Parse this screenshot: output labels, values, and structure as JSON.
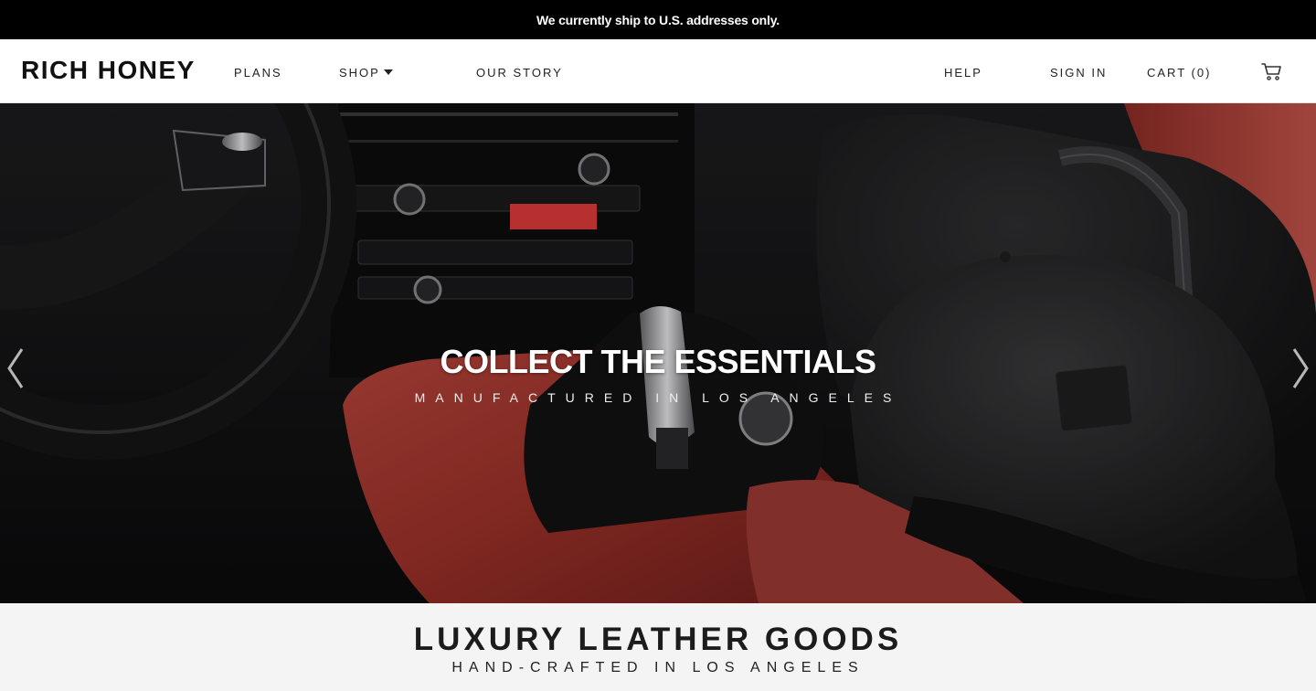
{
  "announcement": {
    "text": "We currently ship to U.S. addresses only."
  },
  "header": {
    "logo": "RICH HONEY",
    "nav_left": [
      {
        "label": "PLANS"
      },
      {
        "label": "SHOP",
        "has_dropdown": true
      },
      {
        "label": "OUR STORY"
      }
    ],
    "nav_right": [
      {
        "label": "HELP"
      },
      {
        "label": "SIGN IN"
      },
      {
        "label": "CART (0)"
      }
    ],
    "cart_icon": "cart-icon"
  },
  "hero": {
    "title": "COLLECT THE ESSENTIALS",
    "subtitle": "MANUFACTURED IN LOS ANGELES",
    "prev_icon": "chevron-left-icon",
    "next_icon": "chevron-right-icon"
  },
  "intro": {
    "title": "LUXURY LEATHER GOODS",
    "subtitle": "HAND-CRAFTED IN LOS ANGELES"
  },
  "colors": {
    "announcement_bg": "#000000",
    "leather_red": "#a7362f",
    "bottom_bg": "#f4f4f4"
  }
}
